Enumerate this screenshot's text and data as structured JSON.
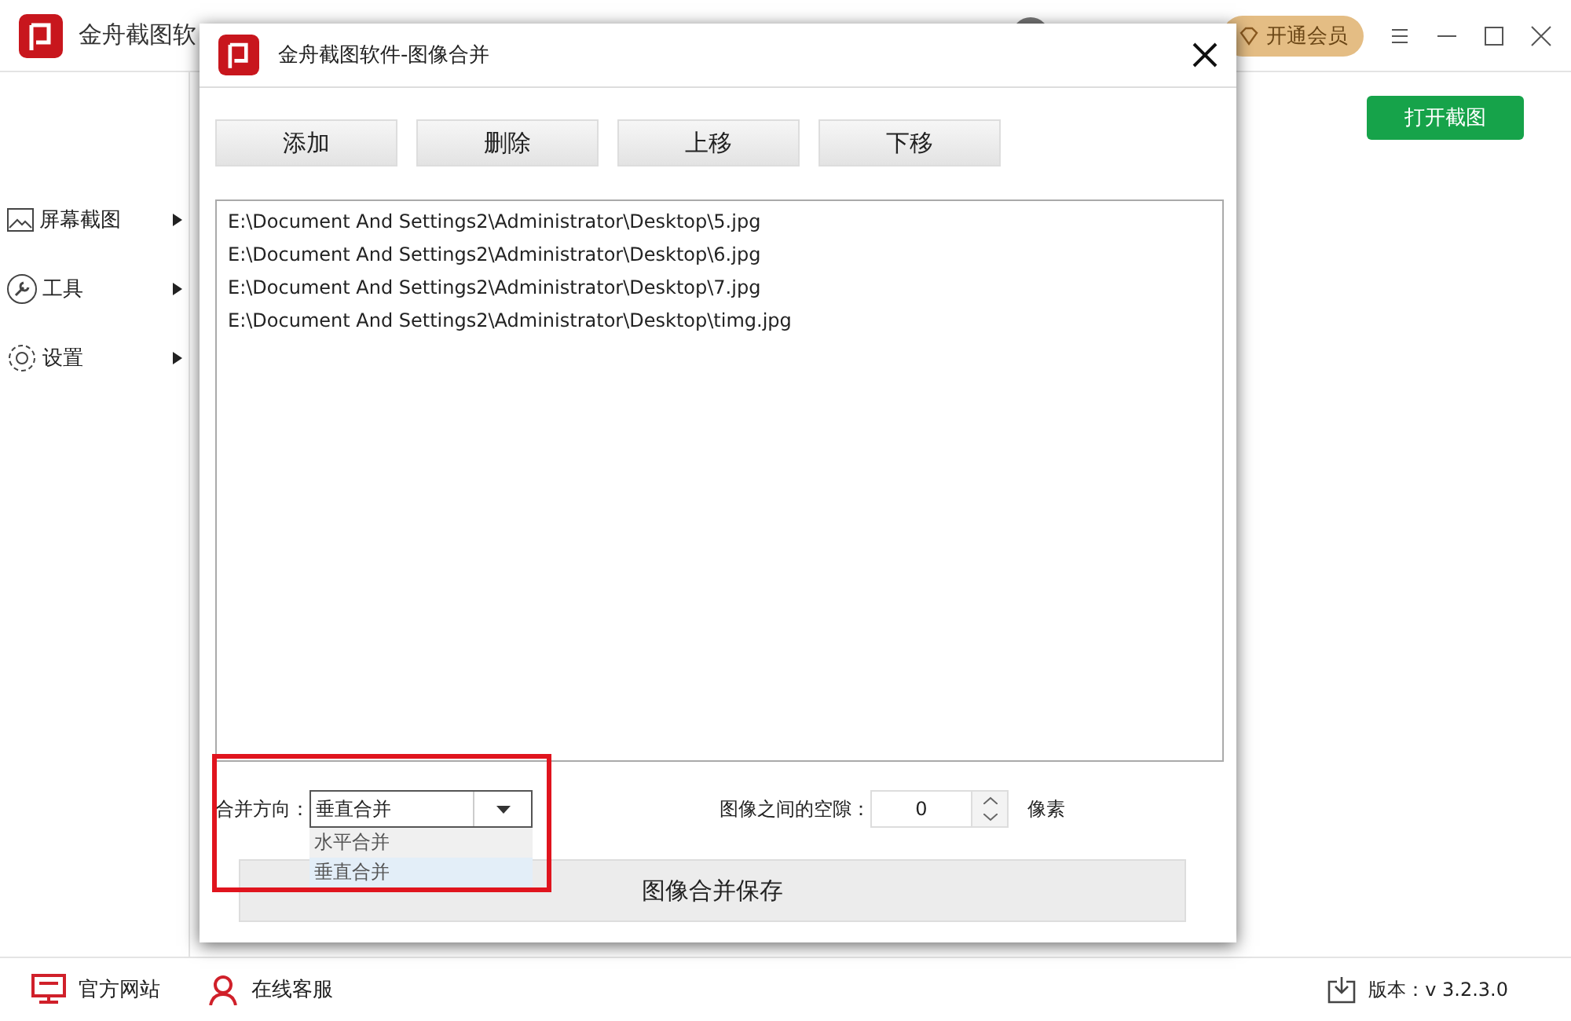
{
  "app": {
    "title": "金舟截图软",
    "member_button": "开通会员",
    "open_button": "打开截图"
  },
  "sidebar": {
    "items": [
      {
        "label": "屏幕截图",
        "kind": "image"
      },
      {
        "label": "工具",
        "kind": "wrench"
      },
      {
        "label": "设置",
        "kind": "gear"
      }
    ]
  },
  "footer": {
    "links": [
      {
        "label": "官方网站",
        "kind": "monitor"
      },
      {
        "label": "在线客服",
        "kind": "person"
      }
    ],
    "version": "版本：v 3.2.3.0"
  },
  "dialog": {
    "title": "金舟截图软件-图像合并",
    "buttons": [
      "添加",
      "删除",
      "上移",
      "下移"
    ],
    "files": [
      "E:\\Document And Settings2\\Administrator\\Desktop\\5.jpg",
      "E:\\Document And Settings2\\Administrator\\Desktop\\6.jpg",
      "E:\\Document And Settings2\\Administrator\\Desktop\\7.jpg",
      "E:\\Document And Settings2\\Administrator\\Desktop\\timg.jpg"
    ],
    "direction_label": "合并方向：",
    "direction_value": "垂直合并",
    "direction_options": [
      {
        "label": "水平合并",
        "selected": false
      },
      {
        "label": "垂直合并",
        "selected": true
      }
    ],
    "gap_label": "图像之间的空隙：",
    "gap_value": "0",
    "gap_unit": "像素",
    "save_button": "图像合并保存"
  }
}
